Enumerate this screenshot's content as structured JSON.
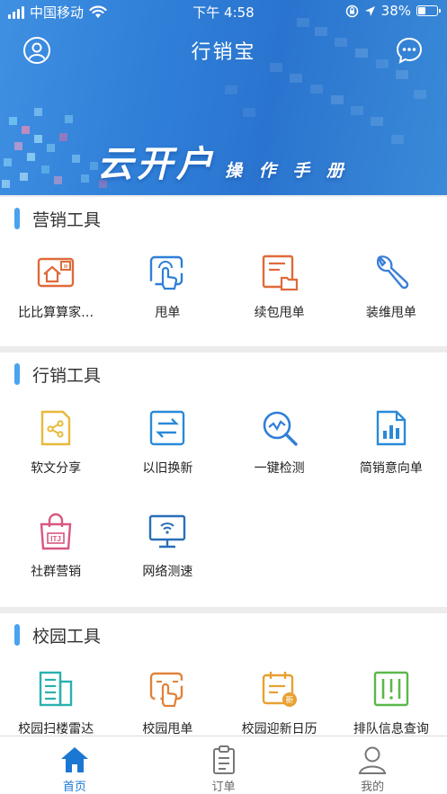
{
  "status_bar": {
    "carrier": "中国移动",
    "time": "下午 4:58",
    "battery": "38%",
    "battery_level": 0.38
  },
  "header": {
    "title": "行销宝",
    "left_icon": "user-icon",
    "right_icon": "message-icon"
  },
  "banner": {
    "headline": "云开户",
    "subline": "操 作 手 册"
  },
  "sections": [
    {
      "title": "营销工具",
      "items": [
        {
          "label": "比比算算家…",
          "icon": "home-compare-icon",
          "color": "#e06a3a"
        },
        {
          "label": "甩单",
          "icon": "touch-screen-icon",
          "color": "#2f7fd8"
        },
        {
          "label": "续包甩单",
          "icon": "document-folder-icon",
          "color": "#e06a3a"
        },
        {
          "label": "装维甩单",
          "icon": "wrench-icon",
          "color": "#3a7fd8"
        }
      ]
    },
    {
      "title": "行销工具",
      "items": [
        {
          "label": "软文分享",
          "icon": "share-document-icon",
          "color": "#e8b93a"
        },
        {
          "label": "以旧换新",
          "icon": "exchange-icon",
          "color": "#2a8ad8"
        },
        {
          "label": "一键检测",
          "icon": "magnifier-chart-icon",
          "color": "#2f7fd8"
        },
        {
          "label": "简销意向单",
          "icon": "bar-chart-file-icon",
          "color": "#2a8ad8"
        },
        {
          "label": "社群营销",
          "icon": "shopping-bag-icon",
          "color": "#d8577e"
        },
        {
          "label": "网络测速",
          "icon": "wifi-monitor-icon",
          "color": "#2a6fb8"
        }
      ]
    },
    {
      "title": "校园工具",
      "items": [
        {
          "label": "校园扫楼雷达",
          "icon": "building-icon",
          "color": "#2ab0b0"
        },
        {
          "label": "校园甩单",
          "icon": "campus-touch-icon",
          "color": "#e0823a"
        },
        {
          "label": "校园迎新日历",
          "icon": "calendar-new-icon",
          "color": "#e8a030"
        },
        {
          "label": "排队信息查询",
          "icon": "queue-info-icon",
          "color": "#5cb84a"
        }
      ]
    }
  ],
  "tabbar": [
    {
      "label": "首页",
      "icon": "home-icon",
      "active": true
    },
    {
      "label": "订单",
      "icon": "clipboard-icon",
      "active": false
    },
    {
      "label": "我的",
      "icon": "person-icon",
      "active": false
    }
  ],
  "colors": {
    "accent": "#1a78d4",
    "section_bar": "#4aa3ee",
    "banner": "#2f7fd8"
  }
}
